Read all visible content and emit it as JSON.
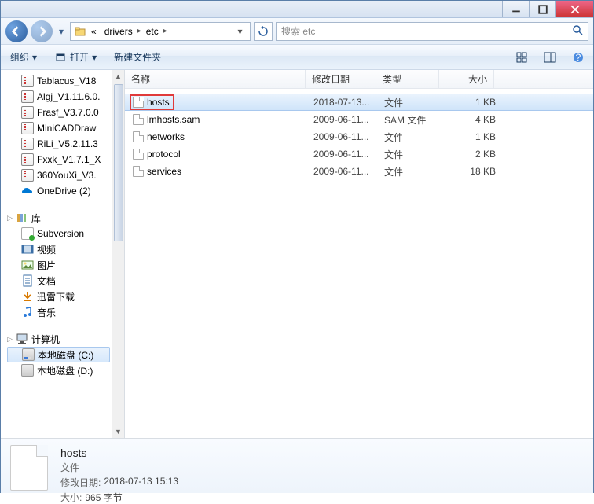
{
  "titlebar": {
    "min": "–",
    "max": "❐",
    "close": "✕"
  },
  "nav": {
    "breadcrumb": {
      "prefix": "«",
      "seg1": "drivers",
      "seg2": "etc"
    },
    "search_placeholder": "搜索 etc"
  },
  "toolbar": {
    "organize": "组织",
    "open": "打开",
    "newfolder": "新建文件夹"
  },
  "sidebar": {
    "items": [
      {
        "label": "Tablacus_V18",
        "icon": "archive"
      },
      {
        "label": "Algj_V1.11.6.0.",
        "icon": "archive"
      },
      {
        "label": "Frasf_V3.7.0.0",
        "icon": "archive"
      },
      {
        "label": "MiniCADDraw",
        "icon": "archive"
      },
      {
        "label": "RiLi_V5.2.11.3",
        "icon": "archive"
      },
      {
        "label": "Fxxk_V1.7.1_X",
        "icon": "archive"
      },
      {
        "label": "360YouXi_V3.",
        "icon": "archive"
      },
      {
        "label": "OneDrive (2)",
        "icon": "onedrive"
      }
    ],
    "lib_header": "库",
    "libs": [
      {
        "label": "Subversion",
        "icon": "svn"
      },
      {
        "label": "视频",
        "icon": "video"
      },
      {
        "label": "图片",
        "icon": "pic"
      },
      {
        "label": "文档",
        "icon": "doc"
      },
      {
        "label": "迅雷下载",
        "icon": "dl"
      },
      {
        "label": "音乐",
        "icon": "music"
      }
    ],
    "computer_header": "计算机",
    "drives": [
      {
        "label": "本地磁盘 (C:)",
        "sel": true
      },
      {
        "label": "本地磁盘 (D:)"
      }
    ]
  },
  "columns": {
    "name": "名称",
    "date": "修改日期",
    "type": "类型",
    "size": "大小"
  },
  "files": [
    {
      "name": "hosts",
      "date": "2018-07-13...",
      "type": "文件",
      "size": "1 KB",
      "sel": true,
      "highlight": true
    },
    {
      "name": "lmhosts.sam",
      "date": "2009-06-11...",
      "type": "SAM 文件",
      "size": "4 KB"
    },
    {
      "name": "networks",
      "date": "2009-06-11...",
      "type": "文件",
      "size": "1 KB"
    },
    {
      "name": "protocol",
      "date": "2009-06-11...",
      "type": "文件",
      "size": "2 KB"
    },
    {
      "name": "services",
      "date": "2009-06-11...",
      "type": "文件",
      "size": "18 KB"
    }
  ],
  "details": {
    "name": "hosts",
    "type": "文件",
    "date_k": "修改日期:",
    "date_v": "2018-07-13 15:13",
    "size_k": "大小:",
    "size_v": "965 字节"
  }
}
